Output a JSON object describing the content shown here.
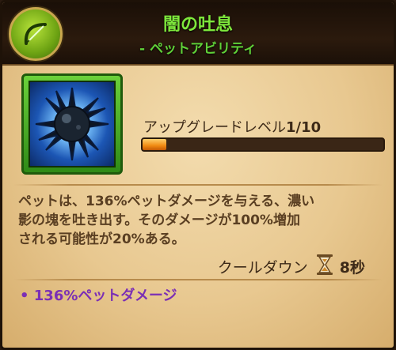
{
  "header": {
    "title": "闇の吐息",
    "subtitle": "- ペットアビリティ",
    "icon": "bow-icon"
  },
  "ability": {
    "icon": "spiked-orb-icon",
    "upgrade_label": "アップグレードレベル",
    "level": "1/10",
    "level_progress": 0.1
  },
  "description": {
    "line1": "ペットは、136%ペットダメージを与える、濃い",
    "line2": "影の塊を吐き出す。そのダメージが100%増加",
    "line3": "される可能性が20%ある。"
  },
  "cooldown": {
    "label": "クールダウン",
    "icon": "hourglass-icon",
    "value": "8秒"
  },
  "bonus": {
    "text": "• 136%ペットダメージ"
  },
  "colors": {
    "title": "#7ee83c",
    "bonus": "#7b2fb5",
    "bar_fill": "#f08a12"
  }
}
